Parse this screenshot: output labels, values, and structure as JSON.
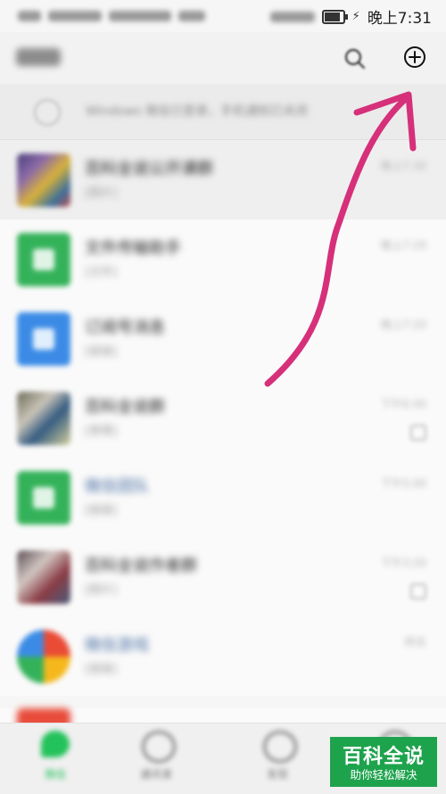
{
  "status_bar": {
    "time": "晚上7:31",
    "battery_level": 0.8
  },
  "header": {
    "title": "微信",
    "search_icon": "search-icon",
    "add_icon": "plus-circle-icon"
  },
  "notice": {
    "text": "Windows 微信已登录，手机通知已关闭"
  },
  "chats": [
    {
      "title": "百科全说公开课群",
      "preview": "[图片]",
      "time": "晚上7:30",
      "avatar": "group-collage"
    },
    {
      "title": "文件传输助手",
      "preview": "[文件]",
      "time": "晚上7:29",
      "avatar": "file-transfer-icon"
    },
    {
      "title": "订阅号消息",
      "preview": "[链接]",
      "time": "晚上7:20",
      "avatar": "subscription-icon"
    },
    {
      "title": "百科全说群",
      "preview": "[表情]",
      "time": "下午6:40",
      "avatar": "group-collage"
    },
    {
      "title": "微信团队",
      "preview": "[链接]",
      "time": "下午5:00",
      "avatar": "wechat-team-icon"
    },
    {
      "title": "百科全说作者群",
      "preview": "[图片]",
      "time": "下午3:20",
      "avatar": "group-collage"
    },
    {
      "title": "微信游戏",
      "preview": "[链接]",
      "time": "昨天",
      "avatar": "wechat-game-icon"
    }
  ],
  "tabs": [
    {
      "label": "微信",
      "active": true
    },
    {
      "label": "通讯录",
      "active": false
    },
    {
      "label": "发现",
      "active": false
    },
    {
      "label": "我",
      "active": false
    }
  ],
  "watermark": {
    "title": "百科全说",
    "subtitle": "助你轻松解决"
  },
  "annotation": {
    "type": "arrow",
    "color": "#d6307a",
    "points_to": "plus-circle-icon"
  }
}
